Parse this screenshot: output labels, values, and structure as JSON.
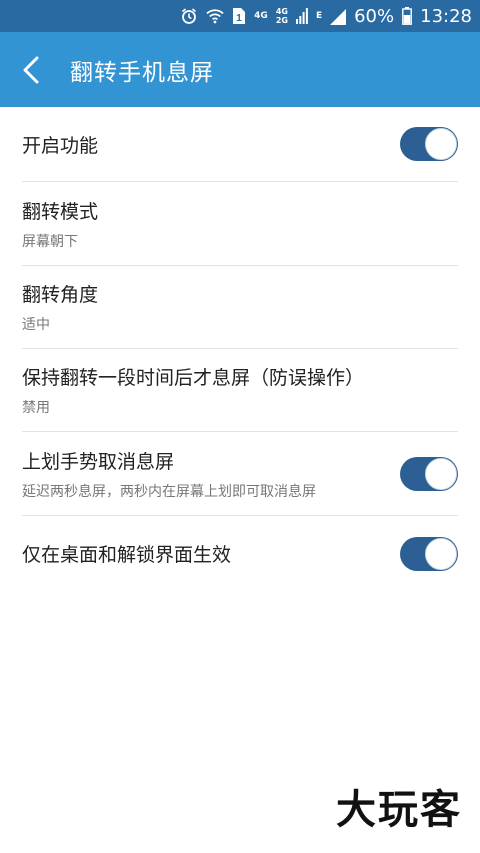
{
  "status_bar": {
    "net_4g": "4G",
    "net_4g_stack_top": "4G",
    "net_2g_stack_bottom": "2G",
    "net_e": "E",
    "battery_percent": "60%",
    "time": "13:28",
    "icons": [
      "alarm-icon",
      "wifi-icon",
      "sim1-icon",
      "signal-icon",
      "battery-icon"
    ]
  },
  "app_bar": {
    "back_icon": "chevron-left-icon",
    "title": "翻转手机息屏",
    "color": "#3294d2"
  },
  "settings": [
    {
      "title": "开启功能",
      "subtitle": "",
      "toggle": true,
      "toggle_on": true
    },
    {
      "title": "翻转模式",
      "subtitle": "屏幕朝下",
      "toggle": false
    },
    {
      "title": "翻转角度",
      "subtitle": "适中",
      "toggle": false
    },
    {
      "title": "保持翻转一段时间后才息屏（防误操作）",
      "subtitle": "禁用",
      "toggle": false
    },
    {
      "title": "上划手势取消息屏",
      "subtitle": "延迟两秒息屏，两秒内在屏幕上划即可取消息屏",
      "toggle": true,
      "toggle_on": true
    },
    {
      "title": "仅在桌面和解锁界面生效",
      "subtitle": "",
      "toggle": true,
      "toggle_on": true
    }
  ],
  "watermark": "大玩客",
  "colors": {
    "toggle_on": "#2c5f93",
    "status_bar": "#2a6aa2"
  }
}
